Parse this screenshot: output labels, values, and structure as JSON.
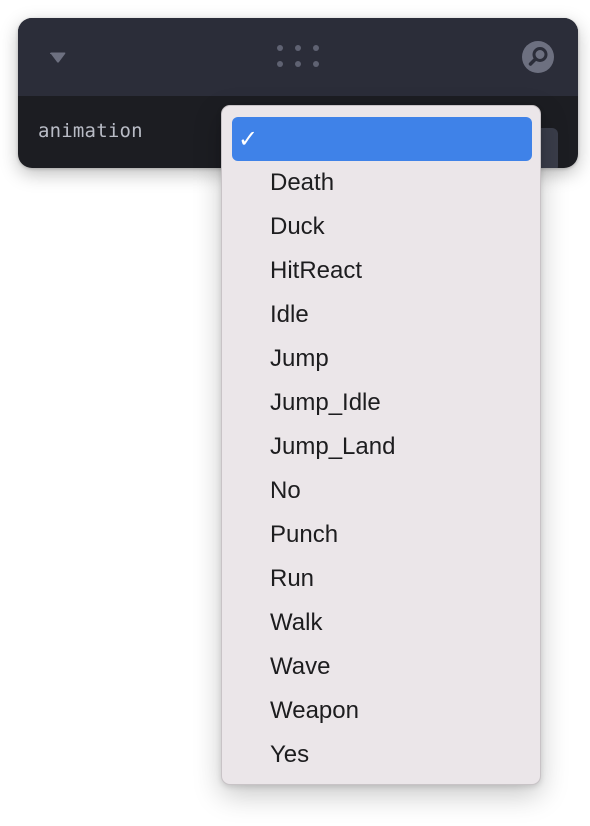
{
  "panel": {
    "collapse_icon": "caret-down-icon",
    "drag_icon": "drag-dots-icon",
    "search_icon": "search-icon",
    "row": {
      "label": "animation",
      "selected_value": ""
    }
  },
  "dropdown": {
    "check_glyph": "✓",
    "accent_color": "#3f82e8",
    "options": [
      {
        "label": "",
        "selected": true
      },
      {
        "label": "Death",
        "selected": false
      },
      {
        "label": "Duck",
        "selected": false
      },
      {
        "label": "HitReact",
        "selected": false
      },
      {
        "label": "Idle",
        "selected": false
      },
      {
        "label": "Jump",
        "selected": false
      },
      {
        "label": "Jump_Idle",
        "selected": false
      },
      {
        "label": "Jump_Land",
        "selected": false
      },
      {
        "label": "No",
        "selected": false
      },
      {
        "label": "Punch",
        "selected": false
      },
      {
        "label": "Run",
        "selected": false
      },
      {
        "label": "Walk",
        "selected": false
      },
      {
        "label": "Wave",
        "selected": false
      },
      {
        "label": "Weapon",
        "selected": false
      },
      {
        "label": "Yes",
        "selected": false
      }
    ]
  }
}
